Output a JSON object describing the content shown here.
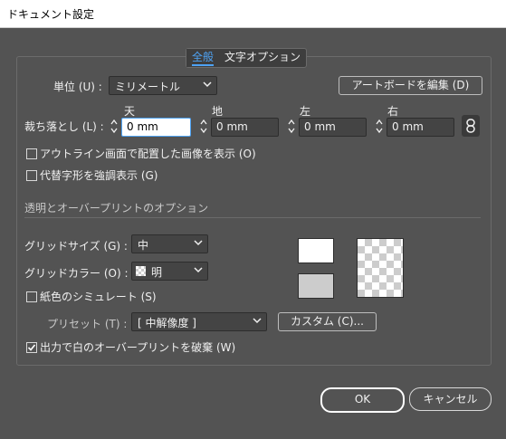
{
  "window": {
    "title": "ドキュメント設定"
  },
  "tabs": [
    {
      "label": "全般",
      "active": true
    },
    {
      "label": "文字オプション",
      "active": false
    }
  ],
  "units": {
    "label": "単位 (U) :",
    "value": "ミリメートル"
  },
  "artboard_button": "アートボードを編集 (D)",
  "bleed": {
    "label": "裁ち落とし (L) :",
    "headers": [
      "天",
      "地",
      "左",
      "右"
    ],
    "values": [
      "0 mm",
      "0 mm",
      "0 mm",
      "0 mm"
    ]
  },
  "options": {
    "show_outline_images": {
      "label": "アウトライン画面で配置した画像を表示 (O)",
      "checked": false
    },
    "highlight_substituted_glyphs": {
      "label": "代替字形を強調表示 (G)",
      "checked": false
    }
  },
  "transparency": {
    "heading": "透明とオーバープリントのオプション",
    "grid_size": {
      "label": "グリッドサイズ (G) :",
      "value": "中"
    },
    "grid_color": {
      "label": "グリッドカラー (O) :",
      "value": "明"
    },
    "simulate_paper": {
      "label": "紙色のシミュレート (S)",
      "checked": false
    }
  },
  "preset": {
    "label": "プリセット (T) :",
    "value": "[ 中解像度 ]",
    "custom_button": "カスタム (C)..."
  },
  "discard_white_overprint": {
    "label": "出力で白のオーバープリントを破棄 (W)",
    "checked": true
  },
  "buttons": {
    "ok": "OK",
    "cancel": "キャンセル"
  },
  "colors": {
    "panel": "#535353",
    "accent": "#4ea3f5",
    "field": "#444444"
  }
}
